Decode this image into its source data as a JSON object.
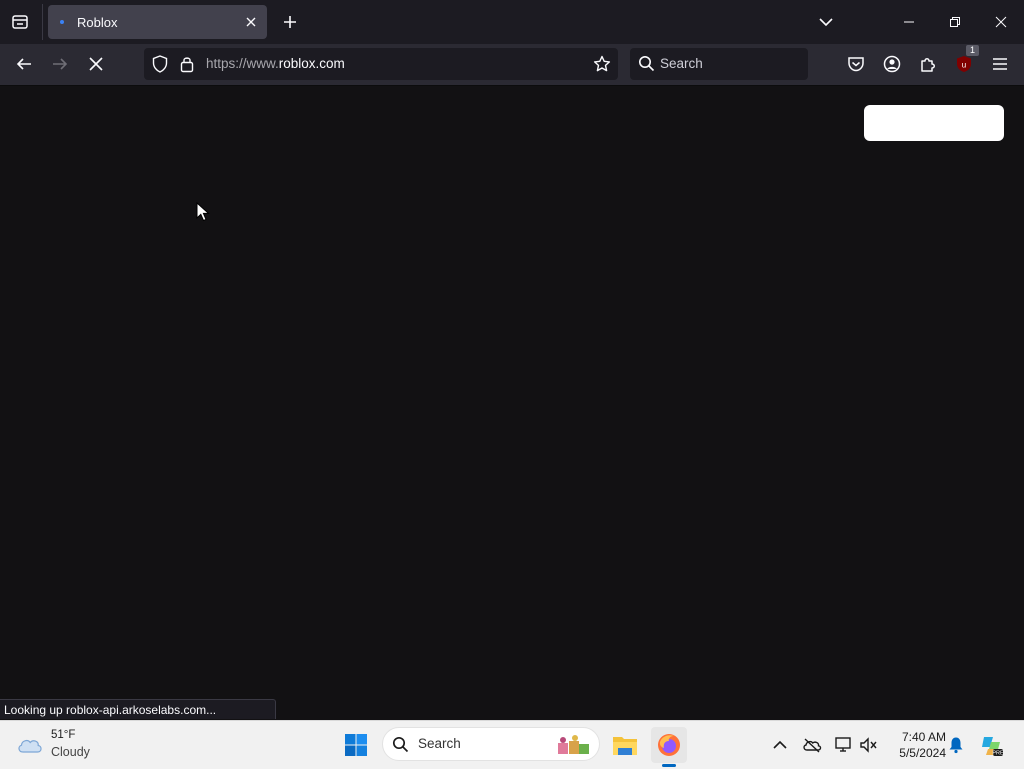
{
  "browser": {
    "tab": {
      "title": "Roblox"
    },
    "url": {
      "prefix": "https://www.",
      "domain": "roblox.com"
    },
    "search": {
      "placeholder": "Search"
    },
    "extension_badge": "1"
  },
  "page": {
    "status_text": "Looking up roblox-api.arkoselabs.com..."
  },
  "taskbar": {
    "weather": {
      "temp": "51°F",
      "condition": "Cloudy"
    },
    "search_label": "Search",
    "clock": {
      "time": "7:40 AM",
      "date": "5/5/2024"
    }
  },
  "colors": {
    "page_bg": "#121113",
    "toolbar_bg": "#2b2a33",
    "tabstrip_bg": "#1c1b22",
    "tab_active": "#42414d",
    "taskbar_bg": "#f1f1f1",
    "accent_blue": "#0067c0"
  },
  "icons": [
    "tab-list-icon",
    "close-icon",
    "plus-icon",
    "chevron-down-icon",
    "minimize-icon",
    "restore-icon",
    "back-arrow-icon",
    "forward-arrow-icon",
    "stop-icon",
    "shield-icon",
    "lock-icon",
    "star-icon",
    "search-icon",
    "pocket-icon",
    "account-icon",
    "extensions-icon",
    "ublock-icon",
    "menu-icon",
    "weather-cloud-icon",
    "windows-start-icon",
    "file-explorer-icon",
    "firefox-icon",
    "chevron-up-icon",
    "onedrive-icon",
    "network-icon",
    "volume-muted-icon",
    "bell-icon",
    "copilot-icon"
  ]
}
